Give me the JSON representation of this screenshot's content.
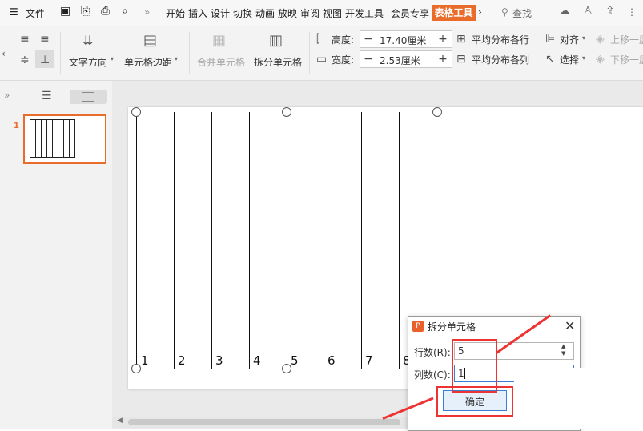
{
  "menubar": {
    "file_label": "文件",
    "items": [
      "开始",
      "插入",
      "设计",
      "切换",
      "动画",
      "放映",
      "审阅",
      "视图",
      "开发工具",
      "会员专享"
    ],
    "active_tab": "表格工具",
    "search_label": "查找"
  },
  "ribbon": {
    "text_direction": "文字方向",
    "cell_margin": "单元格边距",
    "merge_cells": "合并单元格",
    "split_cells": "拆分单元格",
    "height_label": "高度:",
    "height_value": "17.40厘米",
    "width_label": "宽度:",
    "width_value": "2.53厘米",
    "distribute_rows": "平均分布各行",
    "distribute_cols": "平均分布各列",
    "align": "对齐",
    "select": "选择",
    "bring_forward": "上移一层",
    "send_backward": "下移一层"
  },
  "thumbnail": {
    "number": "1"
  },
  "table": {
    "column_labels": [
      "1",
      "2",
      "3",
      "4",
      "5",
      "6",
      "7",
      "8"
    ]
  },
  "dialog": {
    "title": "拆分单元格",
    "rows_label": "行数(R):",
    "rows_value": "5",
    "cols_label": "列数(C):",
    "cols_value": "1",
    "ok_label": "确定"
  },
  "colors": {
    "accent": "#e96c2a",
    "annotation": "#e33333"
  }
}
